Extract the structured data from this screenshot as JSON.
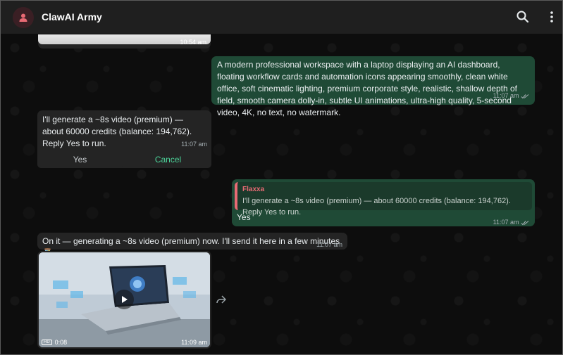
{
  "header": {
    "title": "ClawAI Army",
    "icons": {
      "avatar": "person-icon",
      "search": "search-icon",
      "menu": "more-vertical-icon"
    }
  },
  "messages": {
    "top_media": {
      "time": "10:54 am"
    },
    "prompt": {
      "text": "A modern professional workspace with a laptop displaying an AI dashboard, floating workflow cards and automation icons appearing smoothly, clean white office, soft cinematic lighting, premium corporate style, realistic, shallow depth of field, smooth camera dolly-in, subtle UI animations, ultra-high quality, 5-second video, 4K, no text, no watermark.",
      "time": "11:07 am"
    },
    "confirm": {
      "text": "I'll generate a ~8s video (premium) — about 60000 credits (balance: 194,762). Reply Yes to run.",
      "time": "11:07 am",
      "yes_label": "Yes",
      "cancel_label": "Cancel"
    },
    "reply": {
      "quote_name": "Flaxxa",
      "quote_text": "I'll generate a ~8s video (premium) — about 60000 credits (balance: 194,762). Reply Yes to run.",
      "text": "Yes",
      "time": "11:07 am"
    },
    "status": {
      "text": "On it — generating a ~8s video (premium) now. I'll send it here in a few minutes ⏳",
      "time": "11:07 am"
    },
    "video": {
      "hd_badge": "HD",
      "duration": "0:08",
      "time": "11:09 am"
    }
  },
  "colors": {
    "header_bg": "#1f1f1f",
    "incoming_bubble": "#242424",
    "outgoing_bubble": "#1f4a36",
    "accent_green": "#4cd49a",
    "quote_accent": "#e86a74"
  }
}
